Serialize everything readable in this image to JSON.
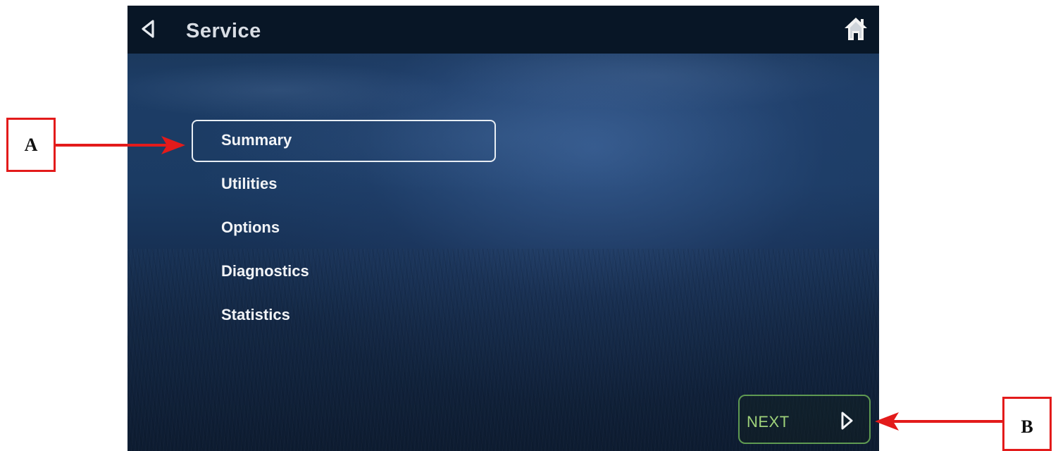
{
  "header": {
    "title": "Service",
    "back_icon": "back-triangle-icon",
    "home_icon": "home-icon"
  },
  "menu": {
    "items": [
      {
        "label": "Summary",
        "selected": true
      },
      {
        "label": "Utilities",
        "selected": false
      },
      {
        "label": "Options",
        "selected": false
      },
      {
        "label": "Diagnostics",
        "selected": false
      },
      {
        "label": "Statistics",
        "selected": false
      }
    ]
  },
  "footer": {
    "next_label": "NEXT",
    "next_icon": "next-triangle-icon"
  },
  "callouts": {
    "a": "A",
    "b": "B"
  },
  "colors": {
    "topbar": "#081626",
    "title_text": "#d8dde4",
    "selection_border": "#e8eef4",
    "next_border": "#5f9a52",
    "next_text": "#9fd27a",
    "callout_red": "#e31b1b"
  }
}
